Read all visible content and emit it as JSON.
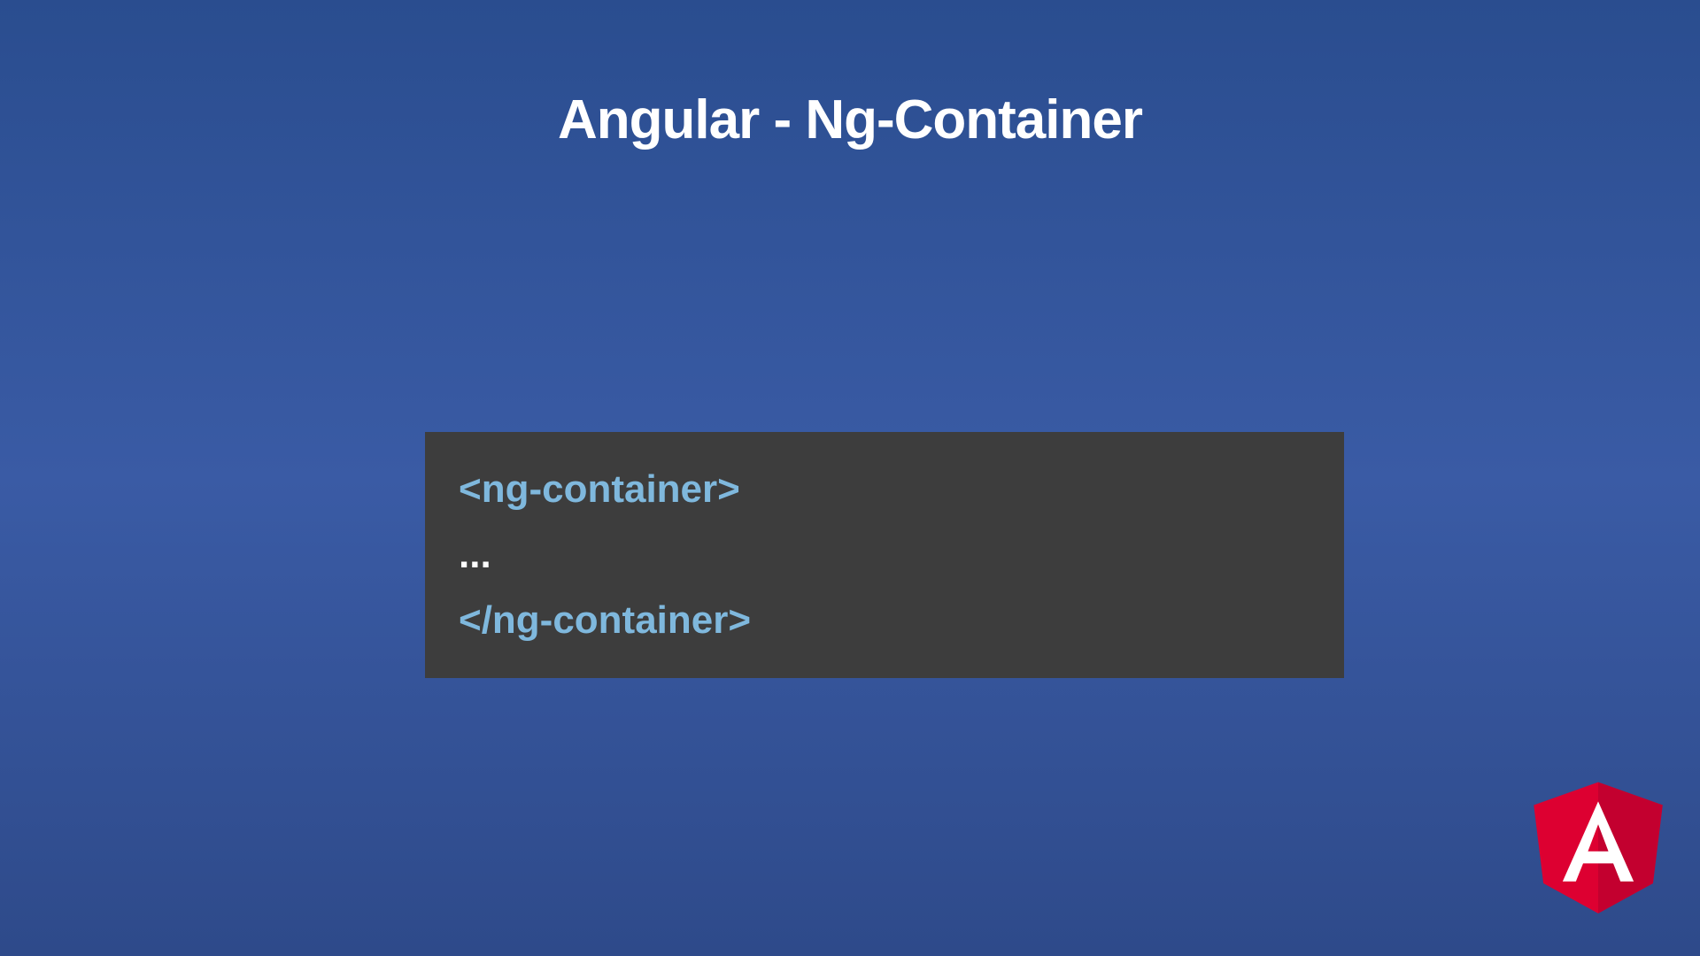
{
  "slide": {
    "title": "Angular - Ng-Container",
    "code": {
      "line1": "<ng-container>",
      "line2": "...",
      "line3": "</ng-container>"
    }
  }
}
